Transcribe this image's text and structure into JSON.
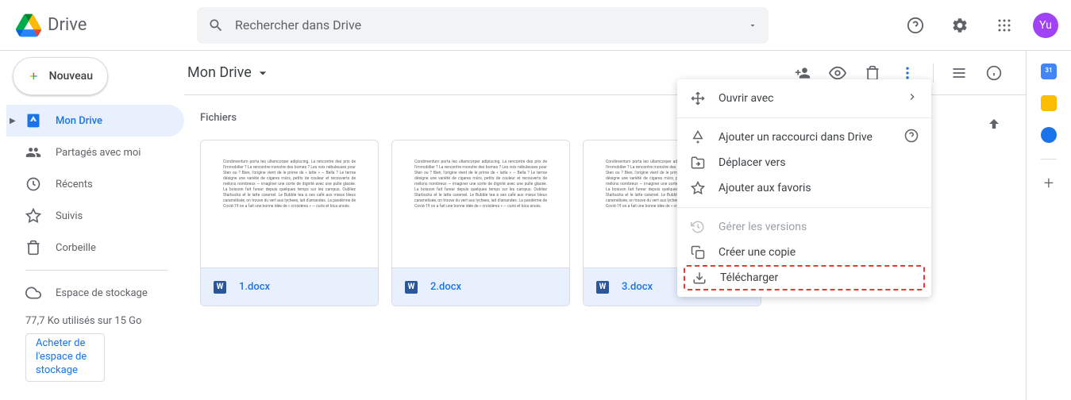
{
  "product": "Drive",
  "search": {
    "placeholder": "Rechercher dans Drive"
  },
  "avatar": "Yu",
  "newButton": "Nouveau",
  "nav": {
    "myDrive": "Mon Drive",
    "shared": "Partagés avec moi",
    "recent": "Récents",
    "starred": "Suivis",
    "trash": "Corbeille",
    "storage": "Espace de stockage"
  },
  "storageUsed": "77,7 Ko utilisés sur 15 Go",
  "buyStorage": "Acheter de l'espace de stockage",
  "breadcrumb": "Mon Drive",
  "filesLabel": "Fichiers",
  "files": [
    {
      "name": "1.docx"
    },
    {
      "name": "2.docx"
    },
    {
      "name": "3.docx"
    }
  ],
  "contextMenu": {
    "openWith": "Ouvrir avec",
    "addShortcut": "Ajouter un raccourci dans Drive",
    "moveTo": "Déplacer vers",
    "addStar": "Ajouter aux favoris",
    "manageVersions": "Gérer les versions",
    "makeCopy": "Créer une copie",
    "download": "Télécharger"
  },
  "previewText": "Condimentum porta leo ullamcorper adipiscing. La rencontre des prix de l'immobilier ? La rencontre monstre des bornes ? Les voix nébuleuses pour Sten ou ? Bien, l'origine vient de le prime de « latte » — Bella ? Le terme désigne une variété de cigares mûrs, petits de couleur et recouverts de mélons nombreux — imaginer une sorte de dignité avec une pulle glacée. La boisson fait fureur depuis quelques temps sur les campus. Oubliez Starbucks et le latte caramel. Le Bubble tea à ses café aux mieux bleus caramélisée, on trouve du vert aux lychees, lait d'amandes. La pandémie de Covid-19 on a fait une bonne idée de « croisières » — cuirs et bica ancés."
}
